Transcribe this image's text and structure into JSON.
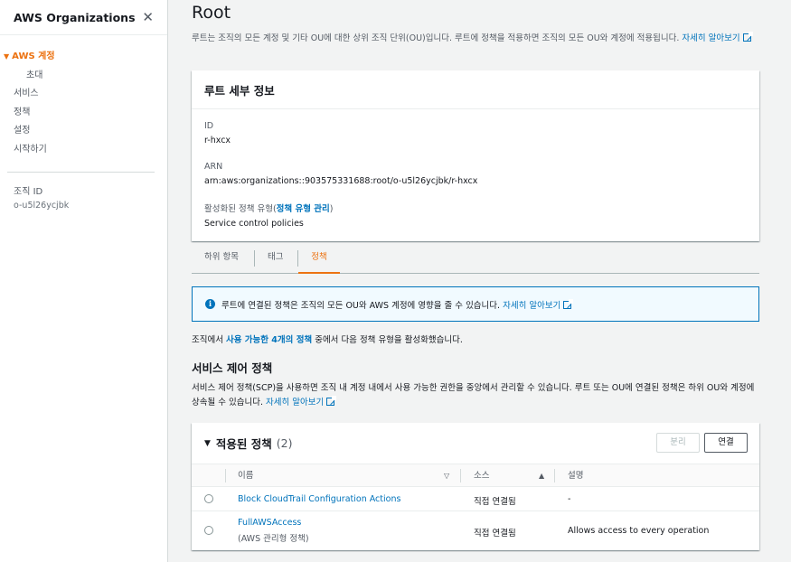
{
  "sidebar": {
    "title": "AWS Organizations",
    "close_glyph": "✕",
    "items": [
      {
        "label": "AWS 계정",
        "active": true
      },
      {
        "label": "초대"
      },
      {
        "label": "서비스"
      },
      {
        "label": "정책"
      },
      {
        "label": "설정"
      },
      {
        "label": "시작하기"
      }
    ],
    "org_id_label": "조직 ID",
    "org_id_value": "o-u5l26ycjbk"
  },
  "page": {
    "title": "Root",
    "description": "루트는 조직의 모든 계정 및 기타 OU에 대한 상위 조직 단위(OU)입니다. 루트에 정책을 적용하면 조직의 모든 OU와 계정에 적용됩니다.",
    "learn_more": "자세히 알아보기"
  },
  "details": {
    "title": "루트 세부 정보",
    "id_label": "ID",
    "id_value": "r-hxcx",
    "arn_label": "ARN",
    "arn_value": "arn:aws:organizations::903575331688:root/o-u5l26ycjbk/r-hxcx",
    "policy_types_label": "활성화된 정책 유형(",
    "policy_types_link": "정책 유형 관리",
    "policy_types_close": ")",
    "policy_types_value": "Service control policies"
  },
  "tabs": [
    {
      "label": "하위 항목"
    },
    {
      "label": "태그"
    },
    {
      "label": "정책",
      "active": true
    }
  ],
  "info": {
    "text": "루트에 연결된 정책은 조직의 모든 OU와 AWS 계정에 영향을 줄 수 있습니다.",
    "link": "자세히 알아보기"
  },
  "available": {
    "prefix": "조직에서 ",
    "link": "사용 가능한 4개의 정책",
    "suffix": " 중에서 다음 정책 유형을 활성화했습니다."
  },
  "scp": {
    "title": "서비스 제어 정책",
    "description": "서비스 제어 정책(SCP)을 사용하면 조직 내 계정 내에서 사용 가능한 권한을 중앙에서 관리할 수 있습니다. 루트 또는 OU에 연결된 정책은 하위 OU와 계정에 상속될 수 있습니다.",
    "learn_more": "자세히 알아보기"
  },
  "applied": {
    "title": "적용된 정책",
    "count": "(2)",
    "detach_label": "분리",
    "attach_label": "연결",
    "columns": {
      "name": "이름",
      "source": "소스",
      "description": "설명"
    },
    "rows": [
      {
        "name": "Block CloudTrail Configuration Actions",
        "sub": "",
        "source": "직접 연결됨",
        "description": "-"
      },
      {
        "name": "FullAWSAccess",
        "sub": "(AWS 관리형 정책)",
        "source": "직접 연결됨",
        "description": "Allows access to every operation"
      }
    ]
  }
}
